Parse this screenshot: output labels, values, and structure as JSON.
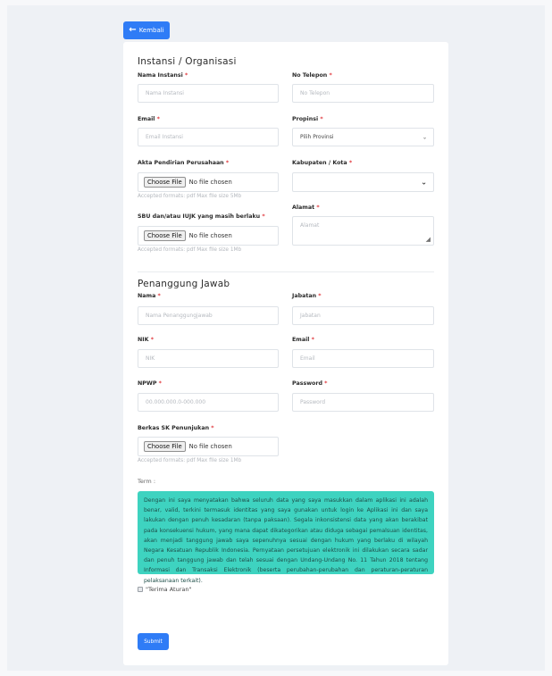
{
  "back_button": {
    "label": "Kembali"
  },
  "org_section": {
    "title": "Instansi / Organisasi",
    "nama_instansi": {
      "label": "Nama Instansi",
      "placeholder": "Nama Instansi"
    },
    "no_telepon": {
      "label": "No Telepon",
      "placeholder": "No Telepon"
    },
    "email": {
      "label": "Email",
      "placeholder": "Email Instansi"
    },
    "propinsi": {
      "label": "Propinsi",
      "selected": "Pilih Provinsi"
    },
    "akta": {
      "label": "Akta Pendirian Perusahaan",
      "button": "Choose File",
      "status": "No file chosen",
      "hint": "Accepted formats: pdf Max file size 5Mb"
    },
    "kabupaten": {
      "label": "Kabupaten / Kota",
      "selected": ""
    },
    "sbu": {
      "label": "SBU dan/atau IUJK yang masih berlaku",
      "button": "Choose File",
      "status": "No file chosen",
      "hint": "Accepted formats: pdf Max file size 1Mb"
    },
    "alamat": {
      "label": "Alamat",
      "placeholder": "Alamat"
    }
  },
  "pj_section": {
    "title": "Penanggung Jawab",
    "nama": {
      "label": "Nama",
      "placeholder": "Nama Penanggungjawab"
    },
    "jabatan": {
      "label": "Jabatan",
      "placeholder": "Jabatan"
    },
    "nik": {
      "label": "NIK",
      "placeholder": "NIK"
    },
    "email": {
      "label": "Email",
      "placeholder": "Email"
    },
    "npwp": {
      "label": "NPWP",
      "placeholder": "00.000.000.0-000.000"
    },
    "password": {
      "label": "Password",
      "placeholder": "Password"
    },
    "berkas": {
      "label": "Berkas SK Penunjukan",
      "button": "Choose File",
      "status": "No file chosen",
      "hint": "Accepted formats: pdf Max file size 1Mb"
    }
  },
  "required_mark": "*",
  "term": {
    "label": "Term :",
    "text": "Dengan ini saya menyatakan bahwa seluruh data yang saya masukkan dalam aplikasi ini adalah benar, valid, terkini termasuk identitas yang saya gunakan untuk login ke Aplikasi ini dan saya lakukan dengan penuh kesadaran (tanpa paksaan). Segala inkonsistensi data yang akan berakibat pada konsekuensi hukum, yang mana dapat dikategorikan atau diduga sebagai pemalsuan identitas, akan menjadi tanggung jawab saya sepenuhnya sesuai dengan hukum yang berlaku di wilayah Negara Kesatuan Republik Indonesia. Pernyataan persetujuan elektronik ini dilakukan secara sadar dan penuh tanggung jawab dan telah sesuai dengan Undang-Undang No. 11 Tahun 2018 tentang Informasi dan Transaksi Elektronik (beserta perubahan-perubahan dan peraturan-peraturan pelaksanaan terkait).",
    "checkbox_label": "\"Terima Aturan\""
  },
  "submit": {
    "label": "Submit"
  },
  "colors": {
    "primary": "#2f7cf6",
    "term_bg": "#3ed3c0",
    "required": "#e0393e"
  }
}
